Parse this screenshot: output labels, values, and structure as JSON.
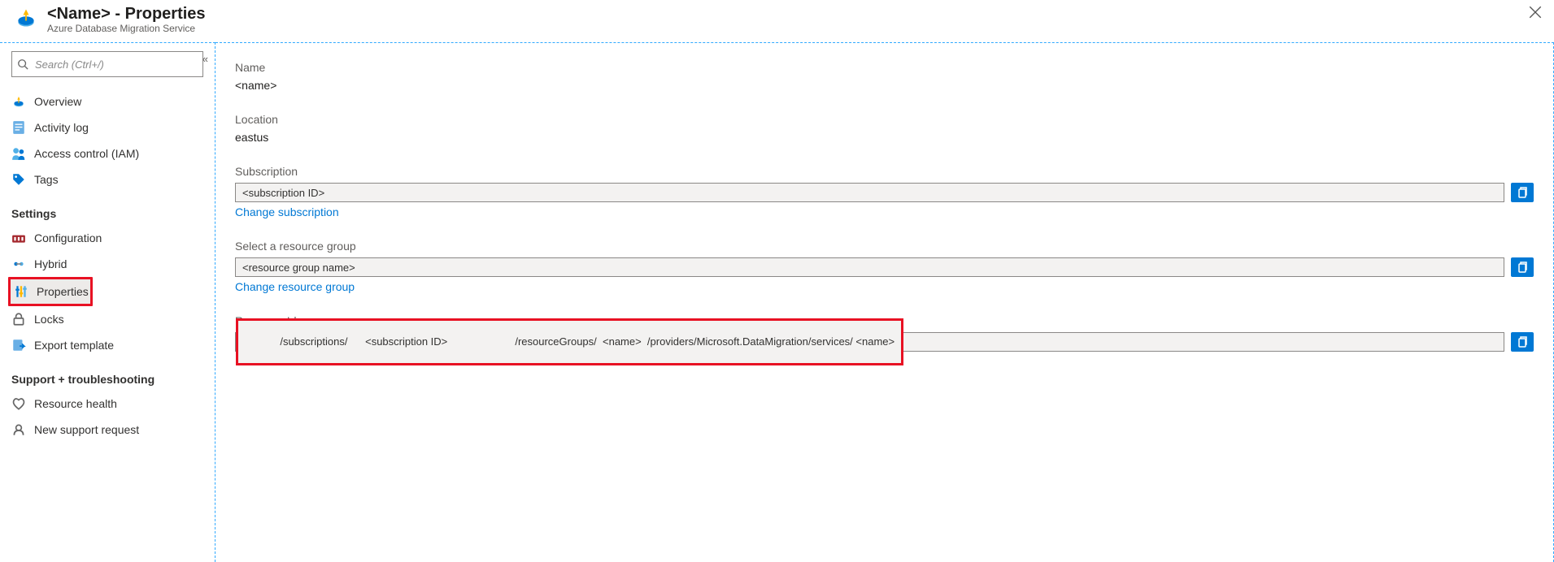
{
  "header": {
    "title": "<Name>       - Properties",
    "subtitle": "Azure Database Migration Service"
  },
  "search": {
    "placeholder": "Search (Ctrl+/)"
  },
  "nav": {
    "top": [
      {
        "label": "Overview"
      },
      {
        "label": "Activity log"
      },
      {
        "label": "Access control (IAM)"
      },
      {
        "label": "Tags"
      }
    ],
    "settings_header": "Settings",
    "settings": [
      {
        "label": "Configuration"
      },
      {
        "label": "Hybrid"
      },
      {
        "label": "Properties"
      },
      {
        "label": "Locks"
      },
      {
        "label": "Export template"
      }
    ],
    "support_header": "Support + troubleshooting",
    "support": [
      {
        "label": "Resource health"
      },
      {
        "label": "New support request"
      }
    ]
  },
  "main": {
    "name": {
      "label": "Name",
      "value": "<name>"
    },
    "location": {
      "label": "Location",
      "value": "eastus"
    },
    "subscription": {
      "label": "Subscription",
      "value": "<subscription ID>",
      "change": "Change subscription"
    },
    "resource_group": {
      "label": "Select a resource group",
      "value": "<resource group name>",
      "change": "Change resource group"
    },
    "resource_id": {
      "label": "Resource Id",
      "value": "/subscriptions/      <subscription ID>                       /resourceGroups/  <name>  /providers/Microsoft.DataMigration/services/ <name>"
    }
  }
}
